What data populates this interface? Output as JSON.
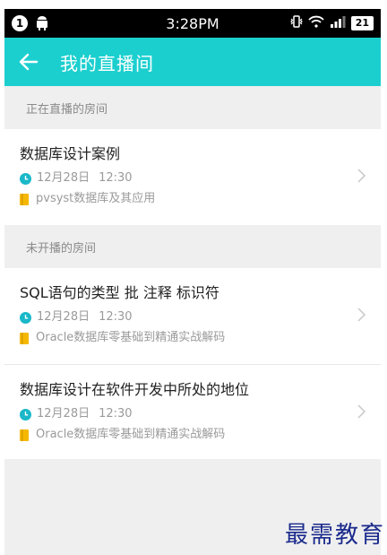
{
  "status_bar": {
    "notification_count": "1",
    "time": "3:28PM",
    "battery": "21"
  },
  "app_bar": {
    "title": "我的直播间",
    "back_icon": "arrow-left-icon"
  },
  "live_section": {
    "header": "正在直播的房间",
    "rooms": [
      {
        "title": "数据库设计案例",
        "date": "12月28日",
        "time": "12:30",
        "course": "pvsyst数据库及其应用"
      }
    ]
  },
  "upcoming_section": {
    "header": "未开播的房间",
    "rooms": [
      {
        "title": "SQL语句的类型 批 注释 标识符",
        "date": "12月28日",
        "time": "12:30",
        "course": "Oracle数据库零基础到精通实战解码"
      },
      {
        "title": "数据库设计在软件开发中所处的地位",
        "date": "12月28日",
        "time": "12:30",
        "course": "Oracle数据库零基础到精通实战解码"
      }
    ]
  },
  "watermark": "最需教育",
  "colors": {
    "accent": "#1ccfcf",
    "clock": "#1ab8c8",
    "book": "#f5b800",
    "background": "#efefef"
  }
}
